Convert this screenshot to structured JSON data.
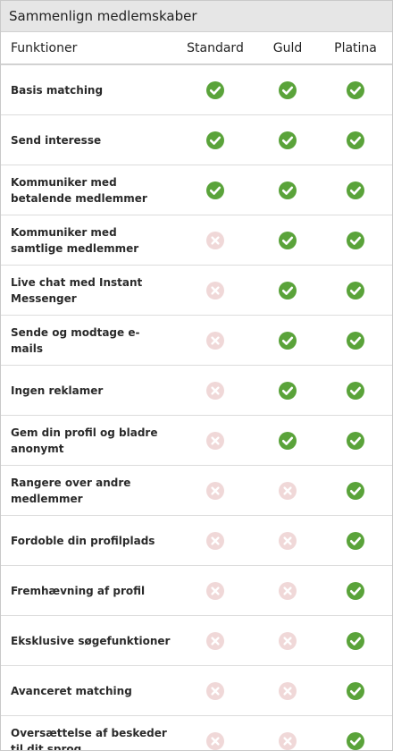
{
  "title": "Sammenlign medlemskaber",
  "header": {
    "feature_col": "Funktioner",
    "plans": [
      "Standard",
      "Guld",
      "Platina"
    ]
  },
  "colors": {
    "check": "#5aa33a",
    "cross": "#f0d8d8",
    "cross_mark": "#ffffff"
  },
  "features": [
    {
      "label": "Basis matching",
      "standard": true,
      "guld": true,
      "platina": true
    },
    {
      "label": "Send interesse",
      "standard": true,
      "guld": true,
      "platina": true
    },
    {
      "label": "Kommuniker med betalende medlemmer",
      "standard": true,
      "guld": true,
      "platina": true
    },
    {
      "label": "Kommuniker med samtlige medlemmer",
      "standard": false,
      "guld": true,
      "platina": true
    },
    {
      "label": "Live chat med Instant Messenger",
      "standard": false,
      "guld": true,
      "platina": true
    },
    {
      "label": "Sende og modtage e-mails",
      "standard": false,
      "guld": true,
      "platina": true
    },
    {
      "label": "Ingen reklamer",
      "standard": false,
      "guld": true,
      "platina": true
    },
    {
      "label": "Gem din profil og bladre anonymt",
      "standard": false,
      "guld": true,
      "platina": true
    },
    {
      "label": "Rangere over andre medlemmer",
      "standard": false,
      "guld": false,
      "platina": true
    },
    {
      "label": "Fordoble din profilplads",
      "standard": false,
      "guld": false,
      "platina": true
    },
    {
      "label": "Fremhævning af profil",
      "standard": false,
      "guld": false,
      "platina": true
    },
    {
      "label": "Eksklusive søgefunktioner",
      "standard": false,
      "guld": false,
      "platina": true
    },
    {
      "label": "Avanceret matching",
      "standard": false,
      "guld": false,
      "platina": true
    },
    {
      "label": "Oversættelse af beskeder til dit sprog",
      "standard": false,
      "guld": false,
      "platina": true
    }
  ]
}
